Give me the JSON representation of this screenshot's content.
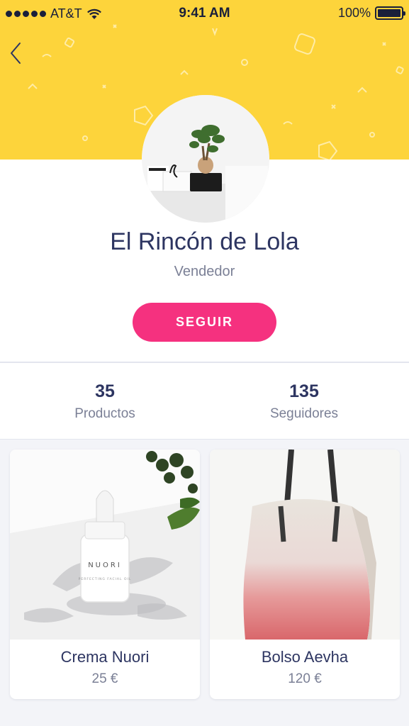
{
  "status_bar": {
    "carrier": "AT&T",
    "time": "9:41 AM",
    "battery": "100%",
    "battery_level": 1.0
  },
  "profile": {
    "name": "El Rincón de Lola",
    "role": "Vendedor",
    "follow_label": "SEGUIR"
  },
  "stats": [
    {
      "value": "35",
      "label": "Productos"
    },
    {
      "value": "135",
      "label": "Seguidores"
    }
  ],
  "products": [
    {
      "title": "Crema Nuori",
      "price": "25 €",
      "bottle_text": "NUORI",
      "bottle_subtext": "PERFECTING FACIAL OIL"
    },
    {
      "title": "Bolso Aevha",
      "price": "120 €"
    }
  ],
  "colors": {
    "header": "#fdd43b",
    "accent": "#f5317f",
    "text_primary": "#2d3561",
    "text_secondary": "#7b8096"
  },
  "icons": {
    "back": "chevron-left-icon",
    "signal": "signal-dots-icon",
    "wifi": "wifi-icon",
    "battery": "battery-icon"
  }
}
